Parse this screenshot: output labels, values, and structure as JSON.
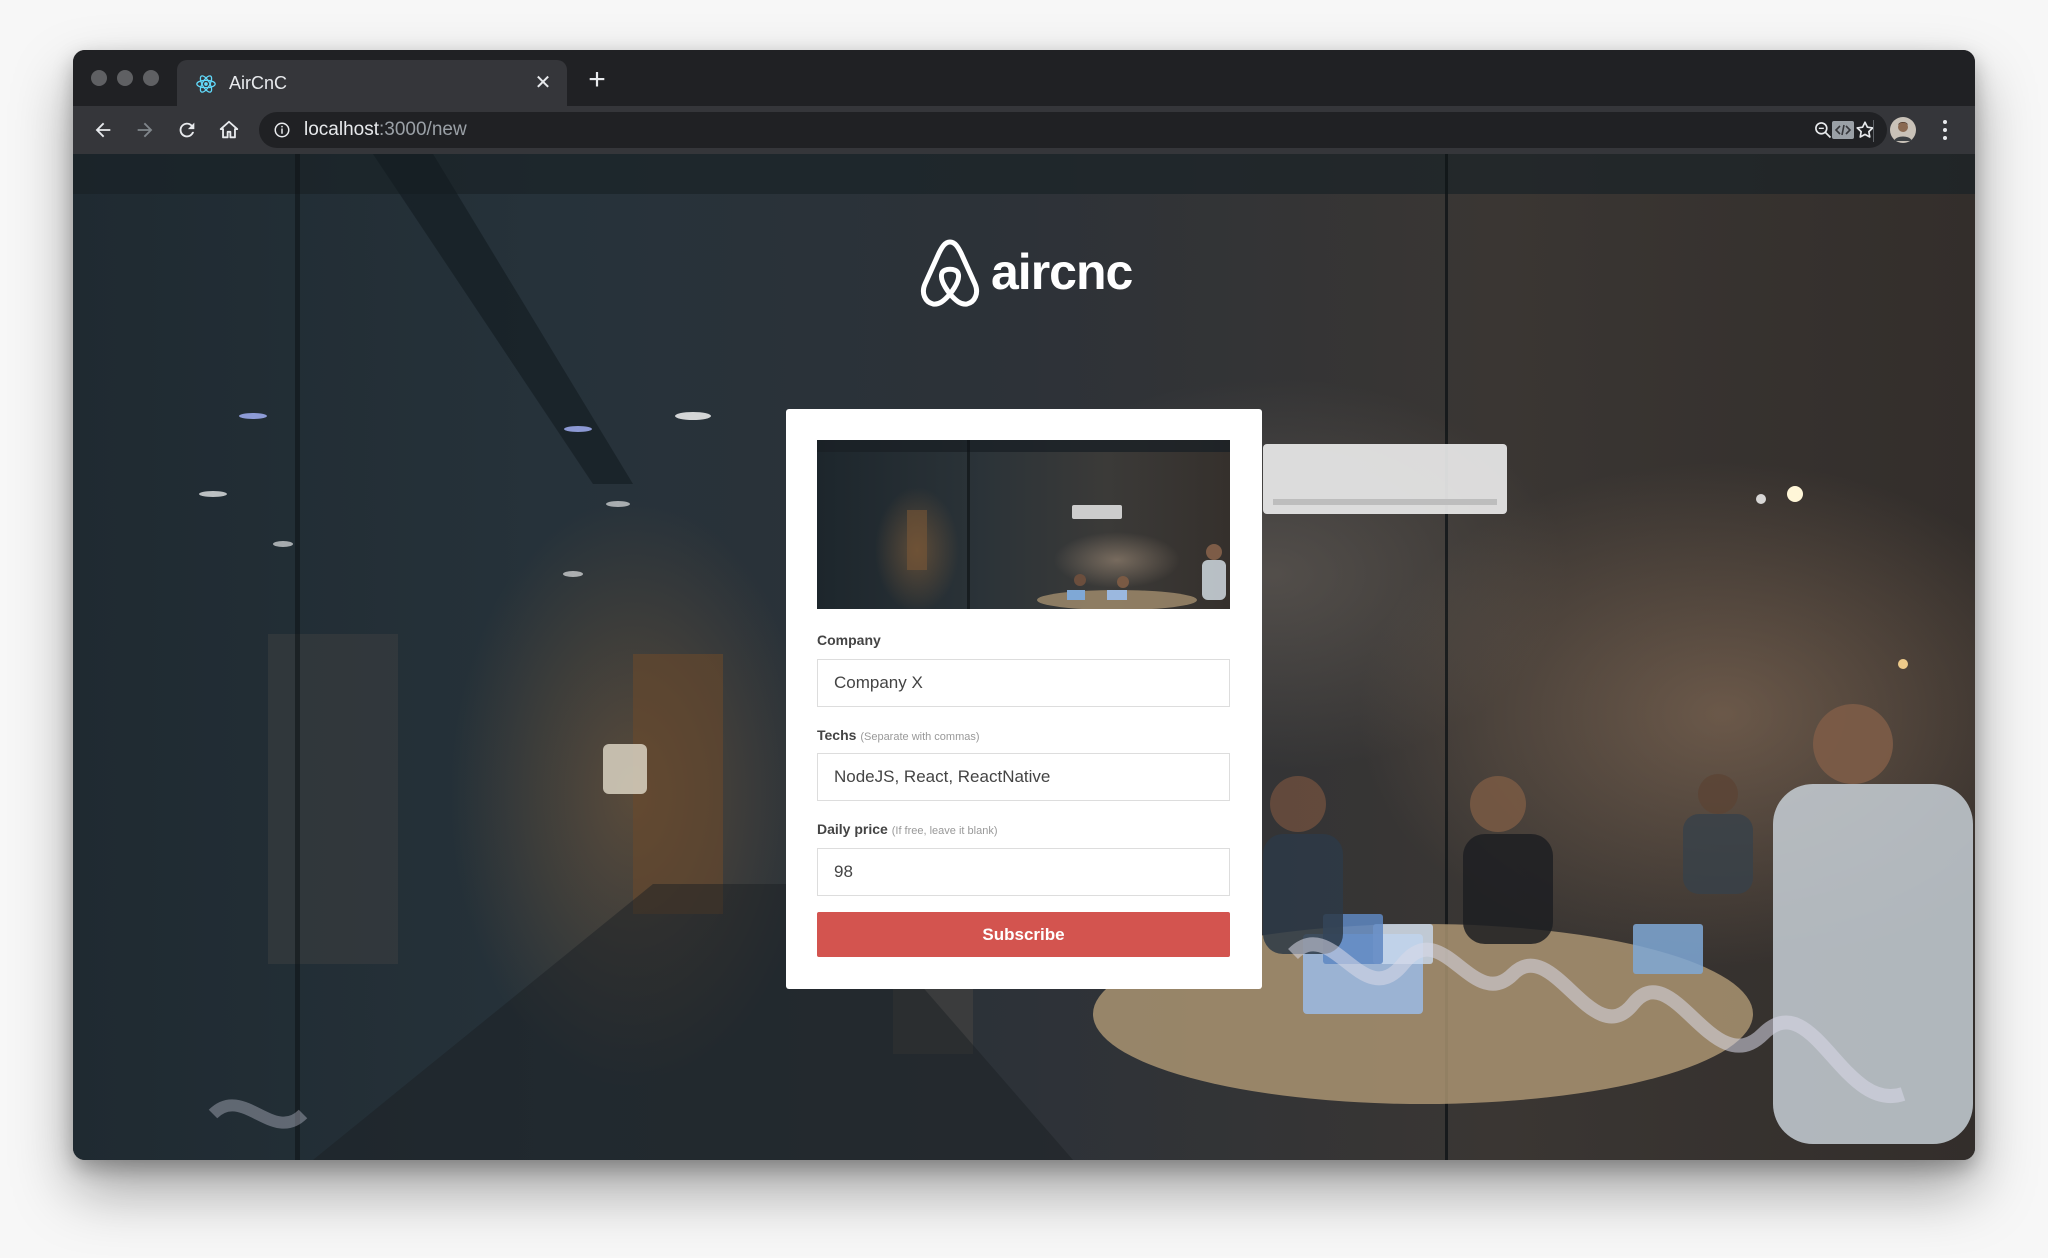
{
  "browser": {
    "tab_title": "AirCnC",
    "url_host": "localhost",
    "url_path": ":3000/new"
  },
  "page": {
    "brand_name": "aircnc",
    "company_label": "Company",
    "company_value": "Company X",
    "techs_label": "Techs",
    "techs_hint": "(Separate with commas)",
    "techs_value": "NodeJS, React, ReactNative",
    "price_label": "Daily price",
    "price_hint": "(If free, leave it blank)",
    "price_value": "98",
    "submit_label": "Subscribe"
  },
  "icons": {
    "favicon": "react-icon",
    "back": "arrow-left-icon",
    "forward": "arrow-right-icon",
    "reload": "reload-icon",
    "home": "home-icon",
    "site_info": "info-icon",
    "zoom": "search-icon",
    "bookmark": "star-icon",
    "extension": "code-icon",
    "profile": "avatar",
    "menu": "more-vertical-icon"
  },
  "colors": {
    "accent": "#d3544f",
    "card": "#ffffff",
    "browser_frame": "#202124"
  }
}
